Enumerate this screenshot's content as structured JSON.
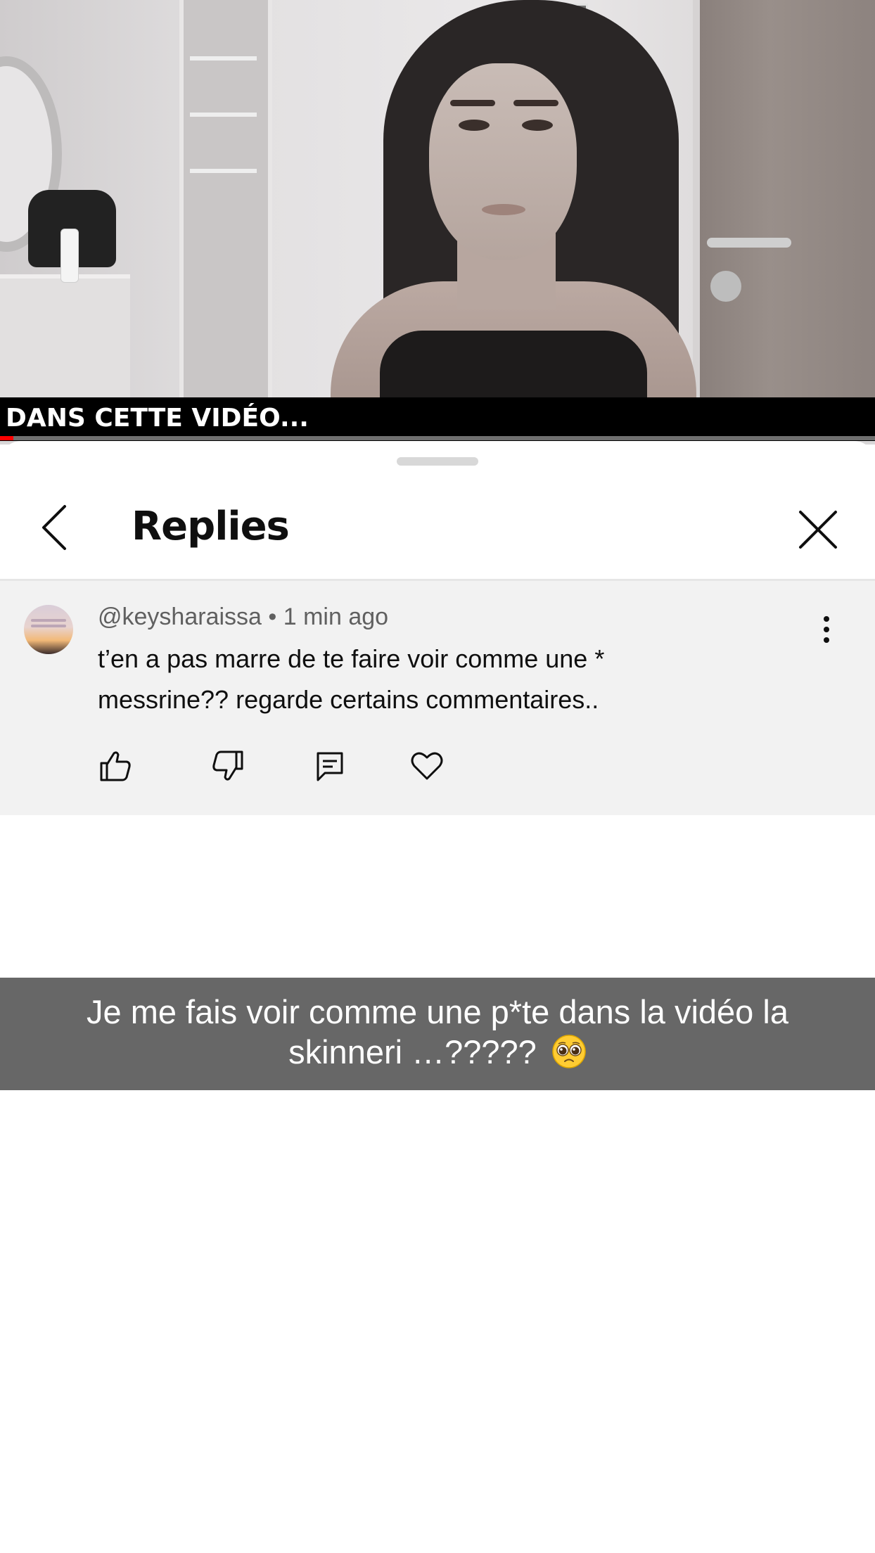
{
  "video": {
    "caption": "DANS CETTE VIDÉO...",
    "progress_fraction": 0.015
  },
  "sheet": {
    "title": "Replies"
  },
  "comment": {
    "handle": "@keysharaissa",
    "separator": "•",
    "time": "1 min ago",
    "text_line1": "t’en a pas marre de te faire voir comme une *",
    "text_line2": "messrine?? regarde certains commentaires.."
  },
  "actions": {
    "icons": [
      "thumbs-up-icon",
      "thumbs-down-icon",
      "reply-icon",
      "heart-icon"
    ]
  },
  "overlay": {
    "line1": "Je me fais voir comme une p*te dans la vidéo la",
    "line2": "skinneri …?????",
    "emoji": "pleading-face-emoji"
  },
  "colors": {
    "progress": "#ff0000",
    "overlay_bg": "#676767",
    "comment_bg": "#f2f2f2"
  }
}
